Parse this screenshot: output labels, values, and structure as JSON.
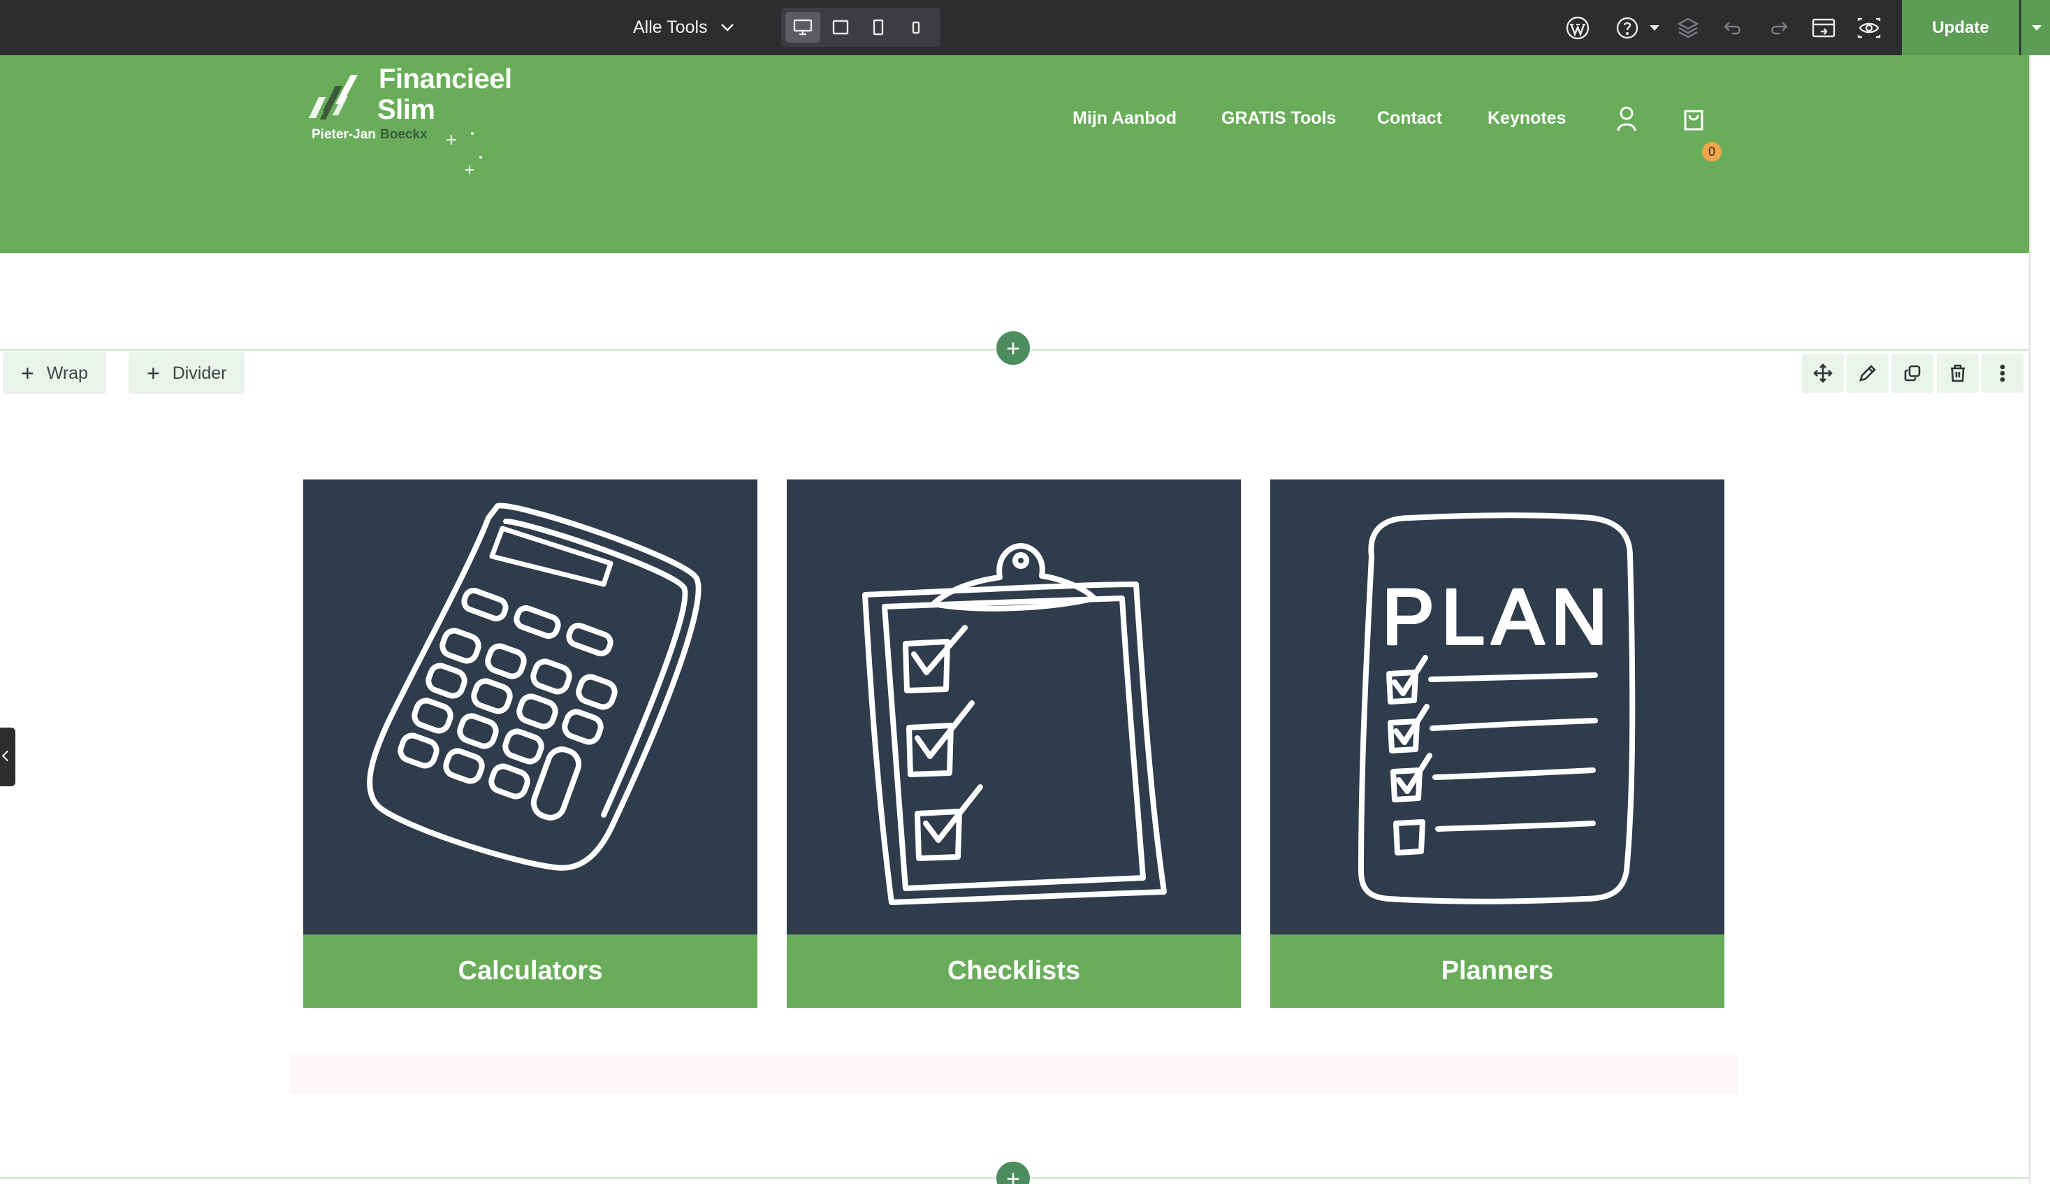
{
  "toolbar": {
    "title": "Alle Tools",
    "update_label": "Update",
    "devices": [
      "desktop",
      "tablet-landscape",
      "tablet-portrait",
      "mobile"
    ],
    "icons": [
      "wordpress-icon",
      "help-icon",
      "layers-icon",
      "undo-icon",
      "redo-icon",
      "preview-window-icon",
      "eye-icon"
    ]
  },
  "header": {
    "logo": {
      "line1": "Financieel",
      "line2": "Slim",
      "author_first": "Pieter-Jan",
      "author_last": "Boeckx"
    },
    "nav": [
      "Mijn Aanbod",
      "GRATIS Tools",
      "Contact",
      "Keynotes"
    ],
    "cart_count": "0"
  },
  "section": {
    "wrap_label": "Wrap",
    "divider_label": "Divider",
    "add_symbol": "+"
  },
  "cards": [
    {
      "label": "Calculators",
      "icon": "calculator-icon"
    },
    {
      "label": "Checklists",
      "icon": "clipboard-checklist-icon"
    },
    {
      "label": "Planners",
      "icon": "plan-list-icon"
    }
  ],
  "plan_text": "PLAN",
  "colors": {
    "toolbar_bg": "#2c2d2f",
    "brand_green": "#69ad5a",
    "card_navy": "#2f3c4c",
    "update_green": "#5c9c55",
    "badge_orange": "#f2a64b"
  }
}
